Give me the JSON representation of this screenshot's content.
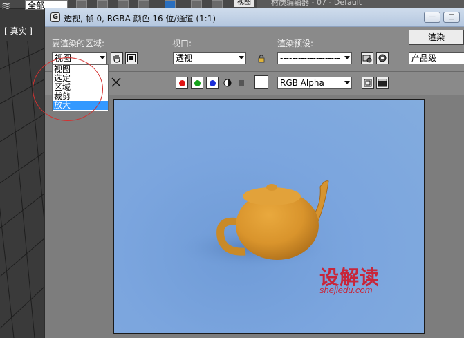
{
  "background_app": {
    "combo_value": "全部",
    "view_tab_label": "视图",
    "material_editor_title": "材质编辑器 - 07 - Default",
    "viewport_label": "[ 真实 ]"
  },
  "window": {
    "title": "透视, 帧 0, RGBA 颜色 16 位/通道 (1:1)",
    "minimize_glyph": "—",
    "maximize_glyph": "□"
  },
  "controls": {
    "area_label": "要渲染的区域:",
    "area_value": "视图",
    "viewport_label": "视口:",
    "viewport_value": "透视",
    "preset_label": "渲染预设:",
    "preset_value": "--------------------",
    "render_button": "渲染",
    "quality_value": "产品级",
    "channel_value": "RGB Alpha"
  },
  "dropdown": {
    "options": [
      "视图",
      "选定",
      "区域",
      "裁剪",
      "放大"
    ],
    "selected_index": 4
  },
  "colors": {
    "red_channel": "#e01414",
    "green_channel": "#16a31c",
    "blue_channel": "#1a2ed8",
    "highlight": "#3399ff",
    "annotation": "#d4302f"
  },
  "watermark": {
    "logo_text": "设解读",
    "url": "shejiedu.com"
  }
}
